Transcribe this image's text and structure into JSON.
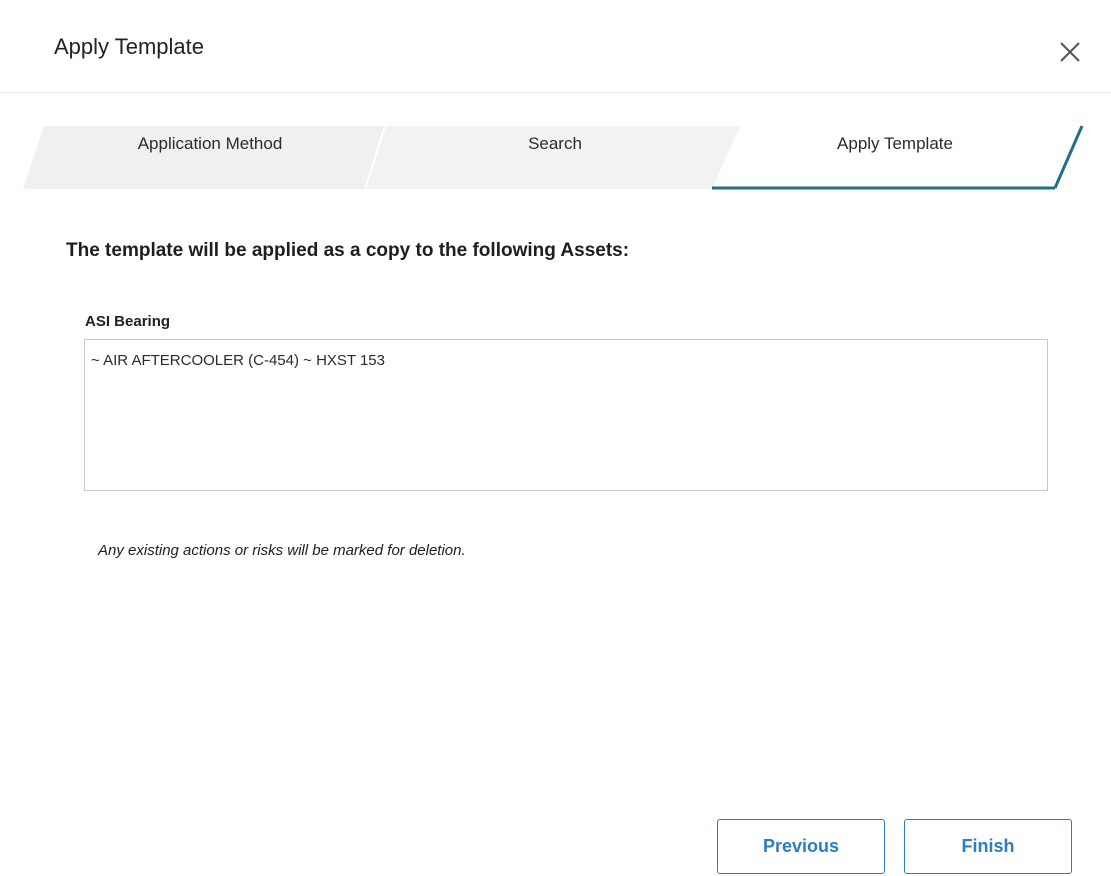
{
  "dialog": {
    "title": "Apply Template",
    "close_icon": "close-icon"
  },
  "steps": [
    {
      "label": "Application Method",
      "state": "completed"
    },
    {
      "label": "Search",
      "state": "completed"
    },
    {
      "label": "Apply Template",
      "state": "active"
    }
  ],
  "content": {
    "message": "The template will be applied as a copy to the following Assets:",
    "field_label": "ASI Bearing",
    "assets": [
      "~ AIR AFTERCOOLER (C-454) ~ HXST 153"
    ],
    "note": "Any existing actions or risks will be marked for deletion."
  },
  "footer": {
    "previous_label": "Previous",
    "finish_label": "Finish"
  },
  "colors": {
    "accent": "#2e7cc1",
    "active_step_underline": "#1f6f8b",
    "step_fill": "#f0f0f0"
  }
}
